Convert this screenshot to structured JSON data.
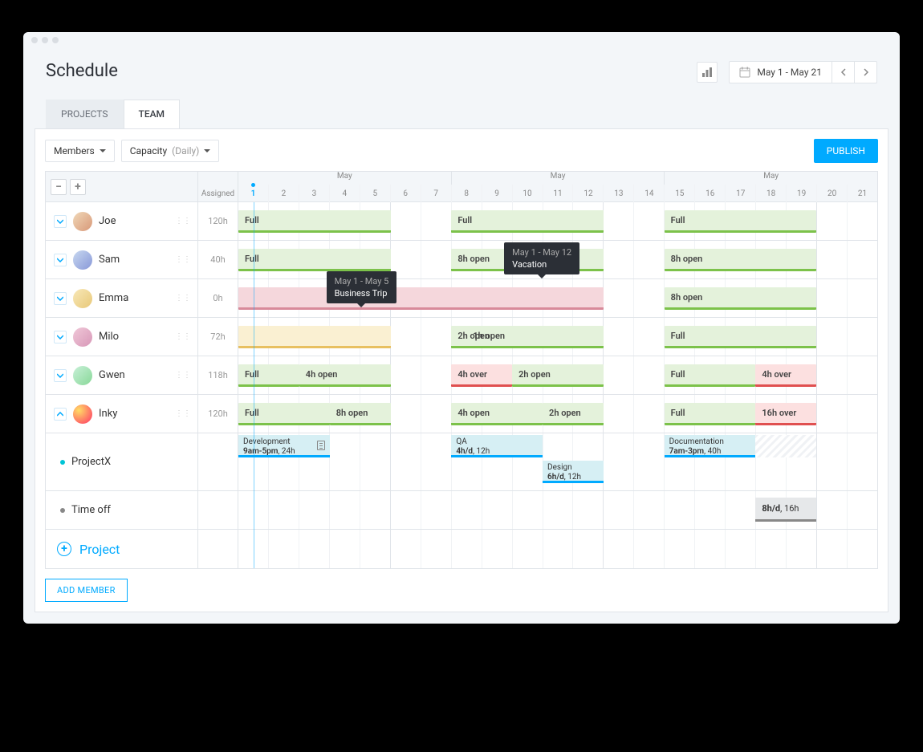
{
  "title": "Schedule",
  "date_range": "May 1 - May 21",
  "tabs": {
    "projects": "PROJECTS",
    "team": "TEAM"
  },
  "filters": {
    "members_label": "Members",
    "capacity_label": "Capacity",
    "capacity_mode": "(Daily)"
  },
  "publish_label": "PUBLISH",
  "columns": {
    "assigned": "Assigned"
  },
  "timeline": {
    "months": [
      "May",
      "May",
      "May"
    ],
    "days": [
      "1",
      "2",
      "3",
      "4",
      "5",
      "6",
      "7",
      "8",
      "9",
      "10",
      "11",
      "12",
      "13",
      "14",
      "15",
      "16",
      "17",
      "18",
      "19",
      "20",
      "21"
    ],
    "today_index": 0,
    "week_breaks": [
      4,
      11,
      18
    ]
  },
  "members": [
    {
      "name": "Joe",
      "assigned": "120h",
      "expanded": false,
      "segments": [
        {
          "start": 0,
          "span": 5,
          "color": "green",
          "label": "Full"
        },
        {
          "start": 7,
          "span": 5,
          "color": "green",
          "label": "Full"
        },
        {
          "start": 14,
          "span": 5,
          "color": "green",
          "label": "Full"
        }
      ]
    },
    {
      "name": "Sam",
      "assigned": "40h",
      "expanded": false,
      "segments": [
        {
          "start": 0,
          "span": 5,
          "color": "green",
          "label": "Full"
        },
        {
          "start": 7,
          "span": 5,
          "color": "green",
          "label": "8h open"
        },
        {
          "start": 14,
          "span": 5,
          "color": "green",
          "label": "8h open"
        }
      ]
    },
    {
      "name": "Emma",
      "assigned": "0h",
      "expanded": false,
      "segments": [
        {
          "start": 0,
          "span": 12,
          "color": "pink",
          "label": ""
        },
        {
          "start": 14,
          "span": 5,
          "color": "green",
          "label": "8h open"
        }
      ],
      "tooltip": {
        "at": 4,
        "date": "May 1 - May 5",
        "text": "Business Trip",
        "nudge": -10
      }
    },
    {
      "name": "Milo",
      "assigned": "72h",
      "expanded": false,
      "segments": [
        {
          "start": 0,
          "span": 5,
          "color": "yellow",
          "label": ""
        },
        {
          "start": 7,
          "span": 5,
          "color": "green",
          "label": "2h open",
          "extra": [
            {
              "at": 3,
              "text": "1h open"
            }
          ]
        },
        {
          "start": 14,
          "span": 5,
          "color": "green",
          "label": "Full"
        }
      ]
    },
    {
      "name": "Gwen",
      "assigned": "118h",
      "expanded": false,
      "segments": [
        {
          "start": 0,
          "span": 2,
          "color": "green",
          "label": "Full"
        },
        {
          "start": 2,
          "span": 3,
          "color": "green",
          "label": "4h open"
        },
        {
          "start": 7,
          "span": 2,
          "color": "red",
          "label": "4h over"
        },
        {
          "start": 9,
          "span": 3,
          "color": "green",
          "label": "2h open"
        },
        {
          "start": 14,
          "span": 3,
          "color": "green",
          "label": "Full"
        },
        {
          "start": 17,
          "span": 2,
          "color": "red",
          "label": "4h over"
        }
      ]
    },
    {
      "name": "Inky",
      "assigned": "120h",
      "expanded": true,
      "segments": [
        {
          "start": 0,
          "span": 3,
          "color": "green",
          "label": "Full"
        },
        {
          "start": 3,
          "span": 2,
          "color": "green",
          "label": "8h open"
        },
        {
          "start": 7,
          "span": 3,
          "color": "green",
          "label": "4h open"
        },
        {
          "start": 10,
          "span": 2,
          "color": "green",
          "label": "2h open"
        },
        {
          "start": 14,
          "span": 3,
          "color": "green",
          "label": "Full"
        },
        {
          "start": 17,
          "span": 2,
          "color": "red",
          "label": "16h over"
        }
      ]
    }
  ],
  "sam_tooltip": {
    "date": "May 1 - May 12",
    "text": "Vacation"
  },
  "inky_projects": [
    {
      "name": "ProjectX",
      "bullet_color": "#00c4d6",
      "tasks": [
        {
          "start": 0,
          "span": 3,
          "title": "Development",
          "time": "9am-5pm",
          "hours": "24h",
          "note": true
        },
        {
          "start": 7,
          "span": 3,
          "title": "QA",
          "time": "4h/d",
          "hours": "12h"
        },
        {
          "start": 10,
          "span": 2,
          "title": "Design",
          "time": "6h/d",
          "hours": "12h",
          "row": 1
        },
        {
          "start": 14,
          "span": 5,
          "title": "Documentation",
          "time": "7am-3pm",
          "hours": "40h",
          "hatch_from": 3
        }
      ]
    },
    {
      "name": "Time off",
      "bullet_color": "#888",
      "timeoff": [
        {
          "start": 17,
          "span": 2,
          "time": "8h/d",
          "hours": "16h"
        }
      ]
    }
  ],
  "add_project_label": "Project",
  "add_member_label": "ADD MEMBER"
}
